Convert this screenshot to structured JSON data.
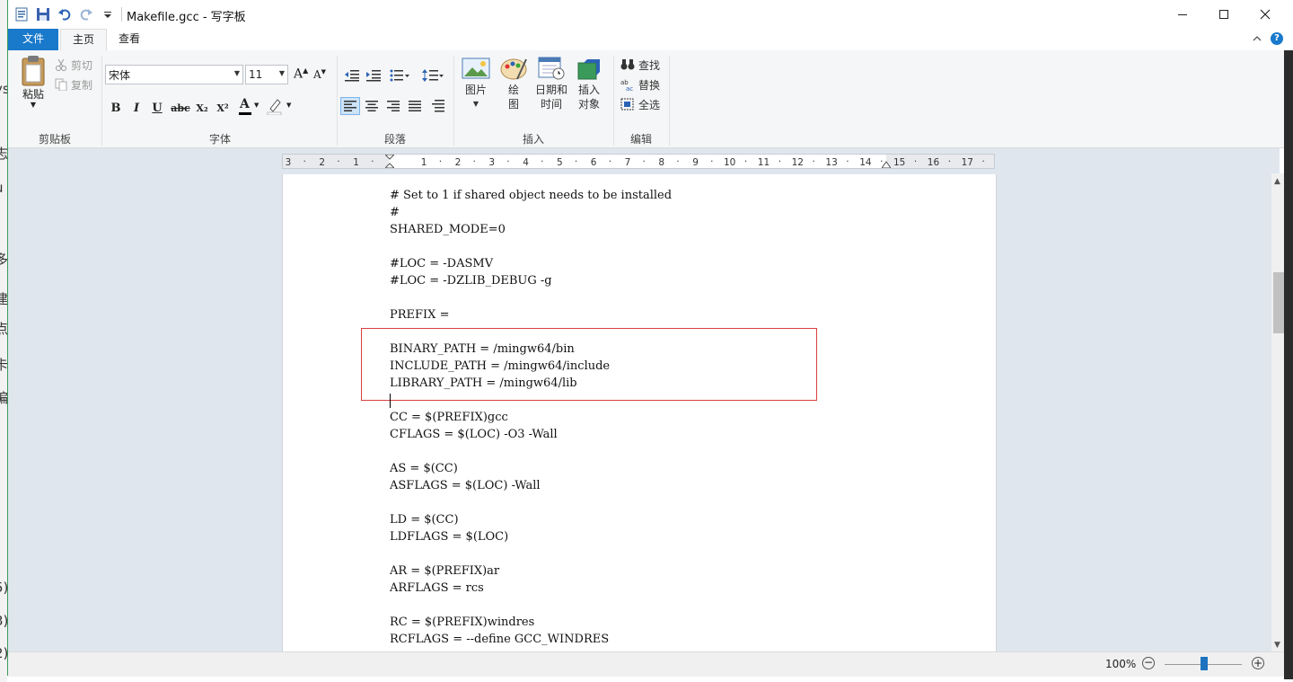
{
  "title": "Makefile.gcc - 写字板",
  "background_chars": [
    "/",
    "ys",
    "f",
    "志",
    "u",
    "多",
    "建",
    "点",
    "卡",
    "编",
    "5)",
    "3)",
    "2)"
  ],
  "tabs": {
    "file": "文件",
    "home": "主页",
    "view": "查看"
  },
  "clipboard": {
    "paste": "粘贴",
    "cut": "剪切",
    "copy": "复制",
    "group": "剪贴板"
  },
  "font": {
    "family": "宋体",
    "size": "11",
    "group": "字体",
    "bold": "B",
    "italic": "I",
    "underline": "U",
    "strike": "abc",
    "subscript": "X₂",
    "superscript": "X²",
    "color_letter": "A"
  },
  "paragraph": {
    "group": "段落"
  },
  "insert": {
    "picture": "图片",
    "paint_1": "绘",
    "paint_2": "图",
    "datetime_1": "日期和",
    "datetime_2": "时间",
    "object_1": "插入",
    "object_2": "对象",
    "group": "插入"
  },
  "editing": {
    "find": "查找",
    "replace": "替换",
    "select_all": "全选",
    "group": "编辑"
  },
  "ruler": [
    "3",
    "2",
    "1",
    "1",
    "2",
    "3",
    "4",
    "5",
    "6",
    "7",
    "8",
    "9",
    "10",
    "11",
    "12",
    "13",
    "14",
    "15",
    "16",
    "17"
  ],
  "document_lines": [
    "# Set to 1 if shared object needs to be installed",
    "#",
    "SHARED_MODE=0",
    "",
    "#LOC = -DASMV",
    "#LOC = -DZLIB_DEBUG -g",
    "",
    "PREFIX =",
    "",
    "BINARY_PATH = /mingw64/bin",
    "INCLUDE_PATH = /mingw64/include",
    "LIBRARY_PATH = /mingw64/lib",
    "",
    "CC = $(PREFIX)gcc",
    "CFLAGS = $(LOC) -O3 -Wall",
    "",
    "AS = $(CC)",
    "ASFLAGS = $(LOC) -Wall",
    "",
    "LD = $(CC)",
    "LDFLAGS = $(LOC)",
    "",
    "AR = $(PREFIX)ar",
    "ARFLAGS = rcs",
    "",
    "RC = $(PREFIX)windres",
    "RCFLAGS = --define GCC_WINDRES"
  ],
  "status": {
    "zoom": "100%"
  },
  "colors": {
    "accent": "#1979ca",
    "highlight_box": "#d9403d"
  }
}
